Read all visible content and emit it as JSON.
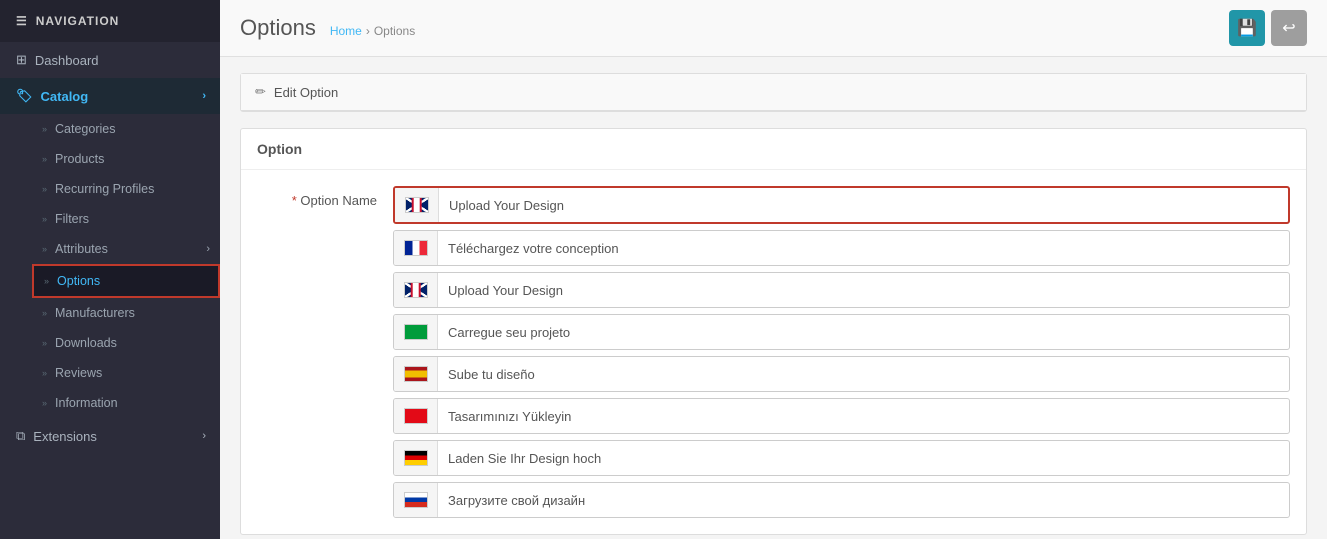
{
  "sidebar": {
    "nav_header": "NAVIGATION",
    "items": [
      {
        "id": "dashboard",
        "label": "Dashboard",
        "icon": "dashboard",
        "active": false,
        "hasArrow": false
      },
      {
        "id": "catalog",
        "label": "Catalog",
        "icon": "tag",
        "active": true,
        "hasArrow": true
      },
      {
        "id": "categories",
        "label": "Categories",
        "sub": true,
        "active": false
      },
      {
        "id": "products",
        "label": "Products",
        "sub": true,
        "active": false
      },
      {
        "id": "recurring-profiles",
        "label": "Recurring Profiles",
        "sub": true,
        "active": false
      },
      {
        "id": "filters",
        "label": "Filters",
        "sub": true,
        "active": false
      },
      {
        "id": "attributes",
        "label": "Attributes",
        "sub": true,
        "active": false,
        "hasArrow": true
      },
      {
        "id": "options",
        "label": "Options",
        "sub": true,
        "active": true
      },
      {
        "id": "manufacturers",
        "label": "Manufacturers",
        "sub": true,
        "active": false
      },
      {
        "id": "downloads",
        "label": "Downloads",
        "sub": true,
        "active": false
      },
      {
        "id": "reviews",
        "label": "Reviews",
        "sub": true,
        "active": false
      },
      {
        "id": "information",
        "label": "Information",
        "sub": true,
        "active": false
      }
    ],
    "extensions_label": "Extensions"
  },
  "topbar": {
    "page_title": "Options",
    "breadcrumb": {
      "home": "Home",
      "separator": "›",
      "current": "Options"
    },
    "actions": {
      "save_title": "Save",
      "back_title": "Back"
    }
  },
  "edit_panel": {
    "heading": "Edit Option"
  },
  "option_section": {
    "title": "Option",
    "form": {
      "label": "* Option Name",
      "entries": [
        {
          "id": "en",
          "flag": "gb",
          "value": "Upload Your Design",
          "highlighted": true
        },
        {
          "id": "fr",
          "flag": "fr",
          "value": "Téléchargez votre conception",
          "highlighted": false
        },
        {
          "id": "en2",
          "flag": "gb2",
          "value": "Upload Your Design",
          "highlighted": false
        },
        {
          "id": "pt",
          "flag": "br",
          "value": "Carregue seu projeto",
          "highlighted": false
        },
        {
          "id": "es",
          "flag": "es",
          "value": "Sube tu diseño",
          "highlighted": false
        },
        {
          "id": "tr",
          "flag": "tr",
          "value": "Tasarımınızı Yükleyin",
          "highlighted": false
        },
        {
          "id": "de",
          "flag": "de",
          "value": "Laden Sie Ihr Design hoch",
          "highlighted": false
        },
        {
          "id": "ru",
          "flag": "ru",
          "value": "Загрузите свой дизайн",
          "highlighted": false
        }
      ]
    }
  }
}
